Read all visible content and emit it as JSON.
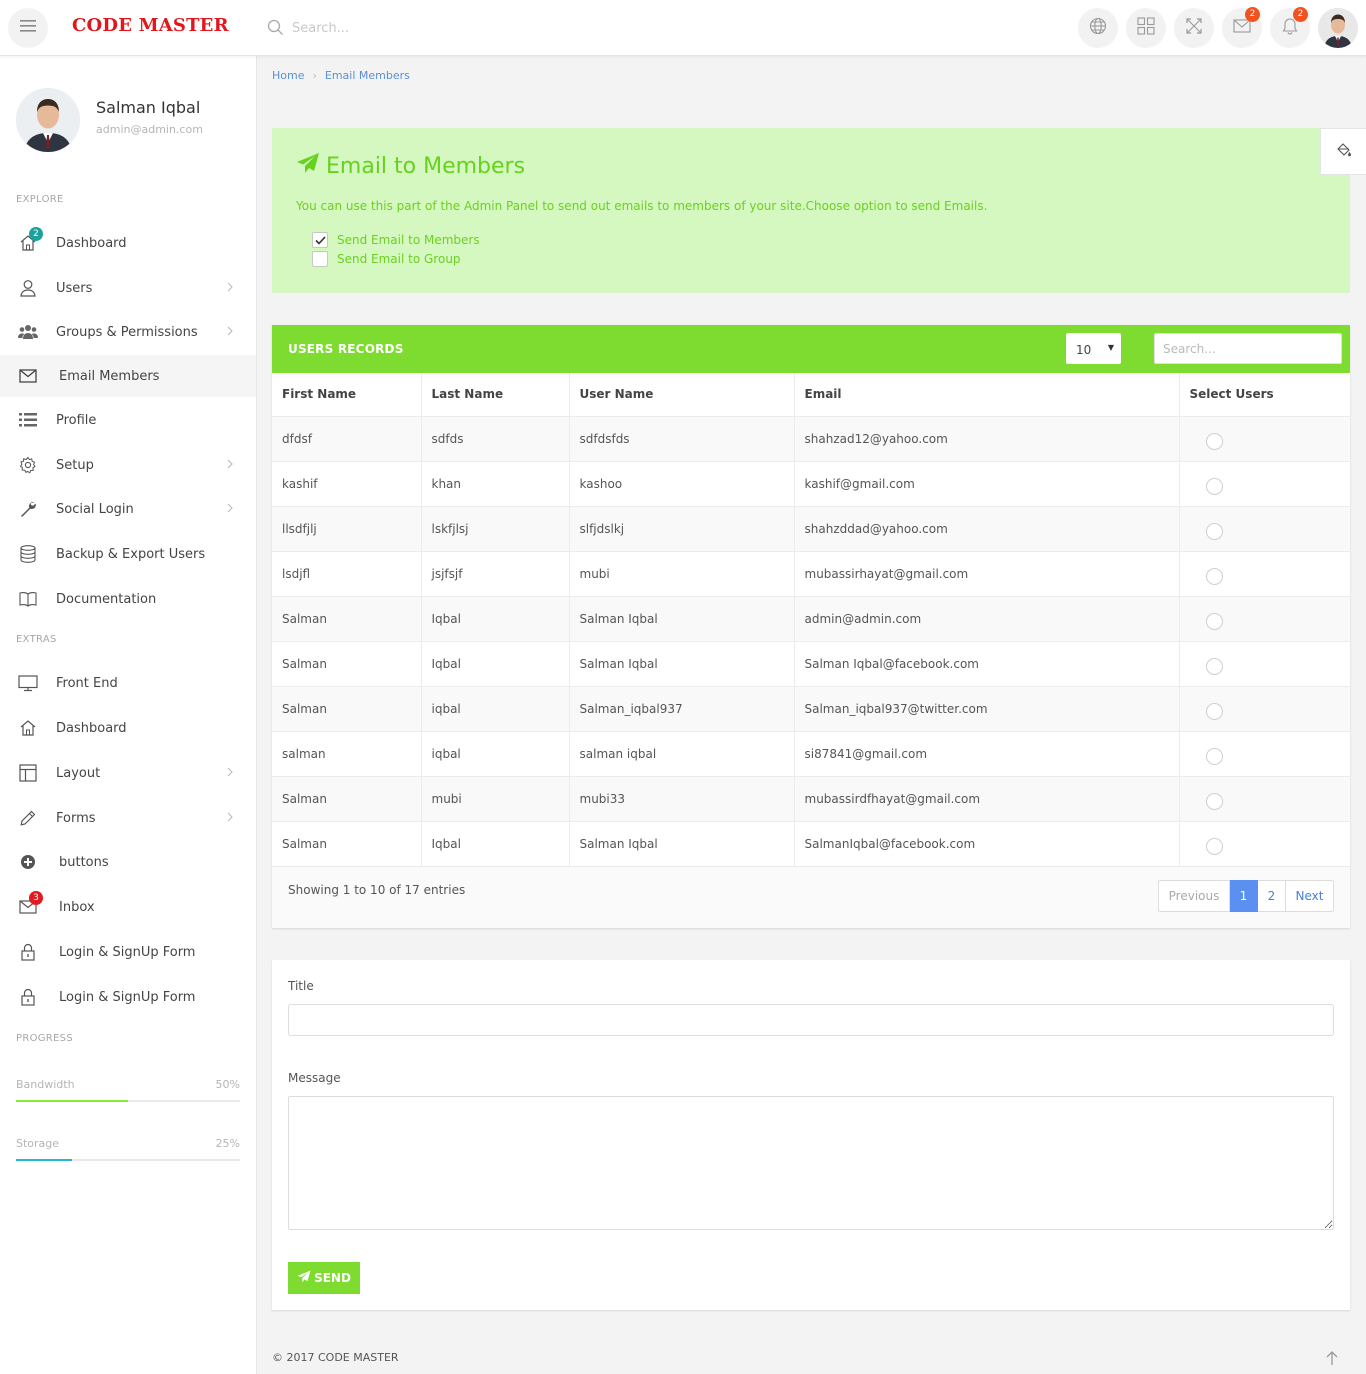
{
  "app": {
    "logo": "CODE MASTER",
    "search_placeholder": "Search...",
    "mail_badge": "2",
    "notif_badge": "2"
  },
  "sidebar": {
    "profile": {
      "name": "Salman Iqbal",
      "email": "admin@admin.com"
    },
    "explore_heading": "EXPLORE",
    "extras_heading": "EXTRAS",
    "progress_heading": "PROGRESS",
    "items": [
      {
        "label": "Dashboard",
        "icon": "home-icon",
        "badge": "2"
      },
      {
        "label": "Users",
        "icon": "user-icon"
      },
      {
        "label": "Groups & Permissions",
        "icon": "group-icon"
      },
      {
        "label": "Email Members",
        "icon": "envelope-icon"
      },
      {
        "label": "Profile",
        "icon": "list-icon"
      },
      {
        "label": "Setup",
        "icon": "gear-icon"
      },
      {
        "label": "Social Login",
        "icon": "wrench-icon"
      },
      {
        "label": "Backup & Export Users",
        "icon": "database-icon"
      },
      {
        "label": "Documentation",
        "icon": "book-icon"
      }
    ],
    "extras": [
      {
        "label": "Front End",
        "icon": "monitor-icon"
      },
      {
        "label": "Dashboard",
        "icon": "home-icon"
      },
      {
        "label": "Layout",
        "icon": "layout-icon"
      },
      {
        "label": "Forms",
        "icon": "pencil-icon"
      },
      {
        "label": "buttons",
        "icon": "plus-circle-icon"
      },
      {
        "label": "Inbox",
        "icon": "envelope-icon",
        "badge": "3"
      },
      {
        "label": "Login & SignUp Form",
        "icon": "lock-icon"
      },
      {
        "label": "Login & SignUp Form",
        "icon": "lock-icon"
      }
    ],
    "progress": [
      {
        "label": "Bandwidth",
        "value": "50%",
        "fraction": 0.5,
        "color": "#8ee83a"
      },
      {
        "label": "Storage",
        "value": "25%",
        "fraction": 0.25,
        "color": "#29b6d9"
      }
    ]
  },
  "breadcrumb": {
    "home": "Home",
    "current": "Email Members"
  },
  "alert": {
    "title": "Email to Members",
    "text": "You can use this part of the Admin Panel to send out emails to members of your site.Choose option to send Emails.",
    "options": [
      {
        "label": "Send Email to Members",
        "checked": true
      },
      {
        "label": "Send Email to Group",
        "checked": false
      }
    ]
  },
  "records": {
    "title": "USERS RECORDS",
    "page_length": "10",
    "search_placeholder": "Search...",
    "columns": [
      "First Name",
      "Last Name",
      "User Name",
      "Email",
      "Select Users"
    ],
    "rows": [
      [
        "dfdsf",
        "sdfds",
        "sdfdsfds",
        "shahzad12@yahoo.com"
      ],
      [
        "kashif",
        "khan",
        "kashoo",
        "kashif@gmail.com"
      ],
      [
        "llsdfjlj",
        "lskfjlsj",
        "slfjdslkj",
        "shahzddad@yahoo.com"
      ],
      [
        "lsdjfl",
        "jsjfsjf",
        "mubi",
        "mubassirhayat@gmail.com"
      ],
      [
        "Salman",
        "Iqbal",
        "Salman Iqbal",
        "admin@admin.com"
      ],
      [
        "Salman",
        "Iqbal",
        "Salman Iqbal",
        "Salman Iqbal@facebook.com"
      ],
      [
        "Salman",
        "iqbal",
        "Salman_iqbal937",
        "Salman_iqbal937@twitter.com"
      ],
      [
        "salman",
        "iqbal",
        "salman iqbal",
        "si87841@gmail.com"
      ],
      [
        "Salman",
        "mubi",
        "mubi33",
        "mubassirdfhayat@gmail.com"
      ],
      [
        "Salman",
        "Iqbal",
        "Salman Iqbal",
        "SalmanIqbal@facebook.com"
      ]
    ],
    "showing": "Showing 1 to 10 of 17 entries",
    "pagination": {
      "previous": "Previous",
      "pages": [
        "1",
        "2"
      ],
      "current": "1",
      "next": "Next"
    }
  },
  "form": {
    "title_label": "Title",
    "title_value": "",
    "message_label": "Message",
    "message_value": "",
    "send_label": "SEND"
  },
  "footer": {
    "copyright": "© 2017 CODE MASTER"
  },
  "colors": {
    "brand_red": "#e1171e",
    "accent_green": "#7ddc2f",
    "alert_bg": "#d4f8c0",
    "link_blue": "#5b8fd8",
    "badge_orange": "#f4511e"
  }
}
